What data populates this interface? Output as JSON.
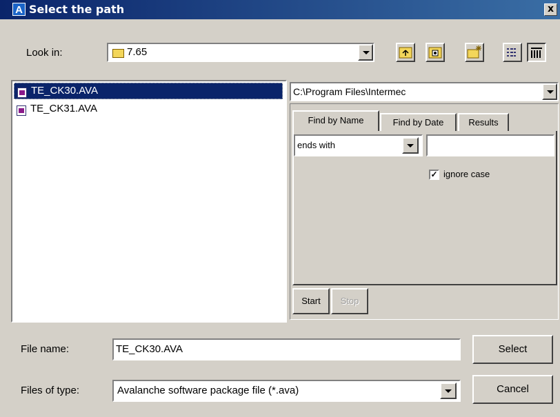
{
  "window": {
    "title": "Select the path",
    "close_glyph": "x"
  },
  "look_in": {
    "label": "Look in:",
    "value": "7.65"
  },
  "file_list": [
    {
      "name": "TE_CK30.AVA",
      "selected": true
    },
    {
      "name": "TE_CK31.AVA",
      "selected": false
    }
  ],
  "search_panel": {
    "path": "C:\\Program Files\\Intermec",
    "tabs": [
      "Find by Name",
      "Find by Date",
      "Results"
    ],
    "match_mode": "ends with",
    "match_text": "",
    "ignore_case_label": "ignore case",
    "ignore_case_checked": true,
    "start_label": "Start",
    "stop_label": "Stop"
  },
  "file_name": {
    "label": "File name:",
    "value": "TE_CK30.AVA"
  },
  "file_type": {
    "label": "Files of type:",
    "value": "Avalanche software package file (*.ava)"
  },
  "buttons": {
    "select": "Select",
    "cancel": "Cancel"
  },
  "colors": {
    "selection": "#0a246a",
    "face": "#d4d0c8",
    "title_start": "#0a246a",
    "title_end": "#3a6ea5"
  }
}
